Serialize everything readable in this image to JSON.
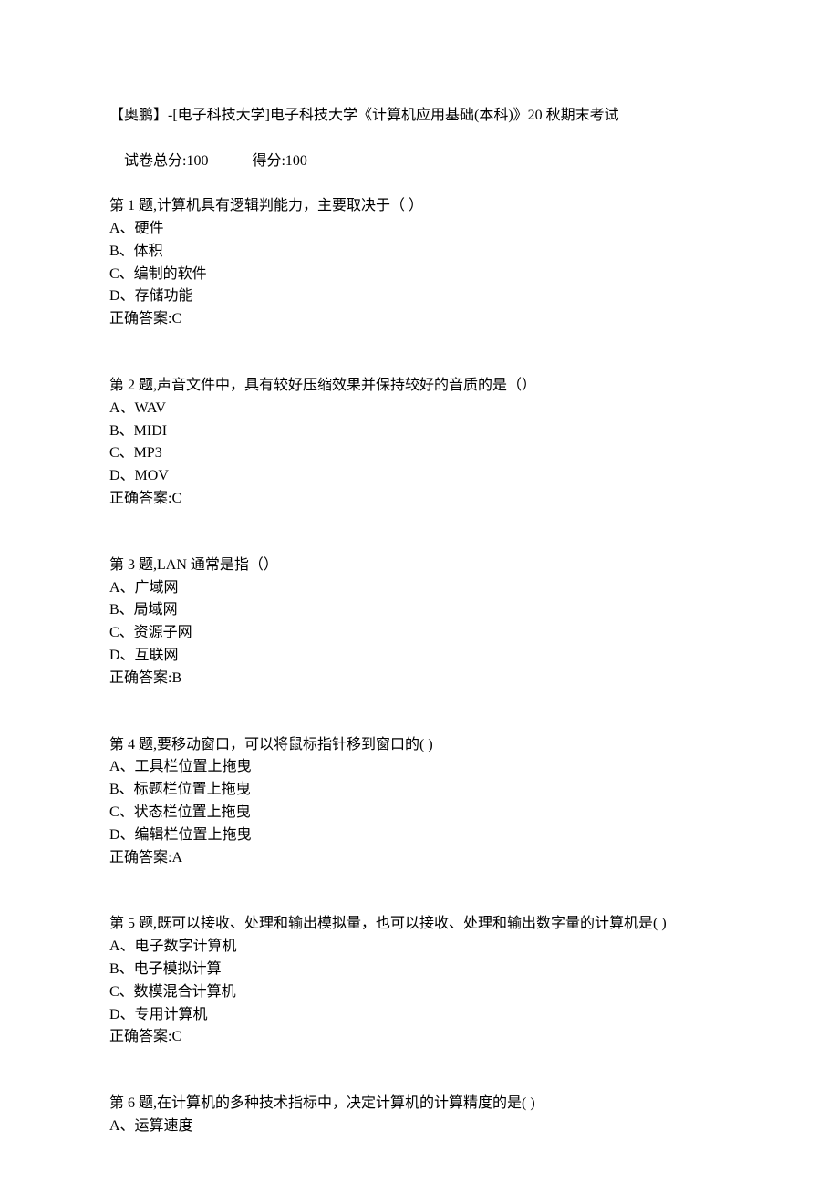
{
  "header": {
    "title": "【奥鹏】-[电子科技大学]电子科技大学《计算机应用基础(本科)》20 秋期末考试",
    "total_score_label": "试卷总分:",
    "total_score_value": "100",
    "got_score_label": "得分:",
    "got_score_value": "100"
  },
  "answer_label": "正确答案:",
  "questions": [
    {
      "stem": "第 1 题,计算机具有逻辑判能力，主要取决于（ ）",
      "options": [
        "A、硬件",
        "B、体积",
        "C、编制的软件",
        "D、存储功能"
      ],
      "answer": "C"
    },
    {
      "stem": "第 2 题,声音文件中，具有较好压缩效果并保持较好的音质的是（）",
      "options": [
        "A、WAV",
        "B、MIDI",
        "C、MP3",
        "D、MOV"
      ],
      "answer": "C"
    },
    {
      "stem": "第 3 题,LAN 通常是指（）",
      "options": [
        "A、广域网",
        "B、局域网",
        "C、资源子网",
        "D、互联网"
      ],
      "answer": "B"
    },
    {
      "stem": "第 4 题,要移动窗口，可以将鼠标指针移到窗口的( )",
      "options": [
        "A、工具栏位置上拖曳",
        "B、标题栏位置上拖曳",
        "C、状态栏位置上拖曳",
        "D、编辑栏位置上拖曳"
      ],
      "answer": "A"
    },
    {
      "stem": "第 5 题,既可以接收、处理和输出模拟量，也可以接收、处理和输出数字量的计算机是( )",
      "options": [
        "A、电子数字计算机",
        "B、电子模拟计算",
        "C、数模混合计算机",
        "D、专用计算机"
      ],
      "answer": "C"
    },
    {
      "stem": "第 6 题,在计算机的多种技术指标中，决定计算机的计算精度的是( )",
      "options": [
        "A、运算速度"
      ],
      "answer": ""
    }
  ]
}
